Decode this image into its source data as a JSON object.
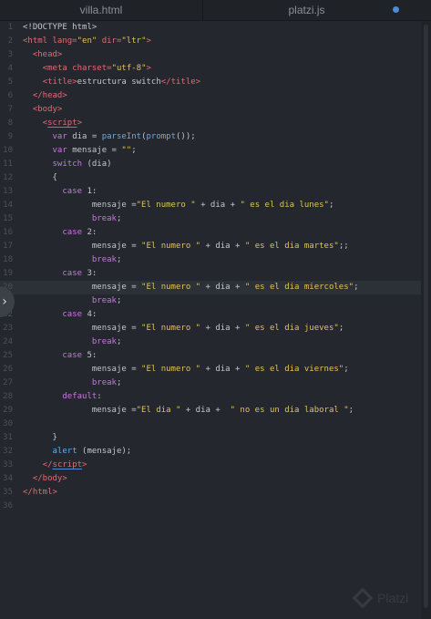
{
  "tabs": [
    {
      "label": "villa.html"
    },
    {
      "label": "platzi.js"
    }
  ],
  "colors": {
    "background": "#24272d",
    "tag": "#e06c75",
    "keyword": "#c678dd",
    "string": "#e0c35a",
    "function": "#61afef",
    "unsaved_dot": "#4d8bd6"
  },
  "active_line": 20,
  "lines": [
    {
      "n": "1",
      "tokens": [
        {
          "t": "<!DOCTYPE html>",
          "c": "pl"
        }
      ]
    },
    {
      "n": "2",
      "tokens": [
        {
          "t": "<html",
          "c": "tag"
        },
        {
          "t": " lang=",
          "c": "tag"
        },
        {
          "t": "\"en\"",
          "c": "str"
        },
        {
          "t": " dir=",
          "c": "tag"
        },
        {
          "t": "\"ltr\"",
          "c": "str"
        },
        {
          "t": ">",
          "c": "tag"
        }
      ]
    },
    {
      "n": "3",
      "tokens": [
        {
          "t": "  "
        },
        {
          "t": "<head>",
          "c": "tag"
        }
      ]
    },
    {
      "n": "4",
      "tokens": [
        {
          "t": "    "
        },
        {
          "t": "<meta",
          "c": "tag"
        },
        {
          "t": " charset=",
          "c": "tag"
        },
        {
          "t": "\"utf-8\"",
          "c": "str"
        },
        {
          "t": ">",
          "c": "tag"
        }
      ]
    },
    {
      "n": "5",
      "tokens": [
        {
          "t": "    "
        },
        {
          "t": "<title>",
          "c": "tag"
        },
        {
          "t": "estructura switch",
          "c": "pl"
        },
        {
          "t": "</title>",
          "c": "tag"
        }
      ]
    },
    {
      "n": "6",
      "tokens": [
        {
          "t": "  "
        },
        {
          "t": "</head>",
          "c": "tag"
        }
      ]
    },
    {
      "n": "7",
      "tokens": [
        {
          "t": "  "
        },
        {
          "t": "<body>",
          "c": "tag"
        }
      ]
    },
    {
      "n": "8",
      "tokens": [
        {
          "t": "    "
        },
        {
          "t": "<",
          "c": "tag"
        },
        {
          "t": "script",
          "c": "tag",
          "u": true
        },
        {
          "t": ">",
          "c": "tag"
        }
      ]
    },
    {
      "n": "9",
      "tokens": [
        {
          "t": "      "
        },
        {
          "t": "var",
          "c": "kw"
        },
        {
          "t": " dia = ",
          "c": "pl"
        },
        {
          "t": "parseInt",
          "c": "fn"
        },
        {
          "t": "(",
          "c": "pl"
        },
        {
          "t": "prompt",
          "c": "fn"
        },
        {
          "t": "());",
          "c": "pl"
        }
      ]
    },
    {
      "n": "10",
      "tokens": [
        {
          "t": "      "
        },
        {
          "t": "var",
          "c": "kw"
        },
        {
          "t": " mensaje = ",
          "c": "pl"
        },
        {
          "t": "\"\"",
          "c": "str"
        },
        {
          "t": ";",
          "c": "pl"
        }
      ]
    },
    {
      "n": "11",
      "tokens": [
        {
          "t": "      "
        },
        {
          "t": "switch",
          "c": "kw"
        },
        {
          "t": " (dia)",
          "c": "pl"
        }
      ]
    },
    {
      "n": "12",
      "tokens": [
        {
          "t": "      {",
          "c": "pl"
        }
      ]
    },
    {
      "n": "13",
      "tokens": [
        {
          "t": "        "
        },
        {
          "t": "case",
          "c": "kw"
        },
        {
          "t": " 1:",
          "c": "pl"
        }
      ]
    },
    {
      "n": "14",
      "tokens": [
        {
          "t": "              mensaje =",
          "c": "pl"
        },
        {
          "t": "\"El numero \"",
          "c": "str"
        },
        {
          "t": " + dia + ",
          "c": "pl"
        },
        {
          "t": "\" es el dia lunes\"",
          "c": "str"
        },
        {
          "t": ";",
          "c": "pl"
        }
      ]
    },
    {
      "n": "15",
      "tokens": [
        {
          "t": "              "
        },
        {
          "t": "break",
          "c": "kw"
        },
        {
          "t": ";",
          "c": "pl"
        }
      ]
    },
    {
      "n": "16",
      "tokens": [
        {
          "t": "        "
        },
        {
          "t": "case",
          "c": "kw"
        },
        {
          "t": " 2:",
          "c": "pl"
        }
      ]
    },
    {
      "n": "17",
      "tokens": [
        {
          "t": "              mensaje = ",
          "c": "pl"
        },
        {
          "t": "\"El numero \"",
          "c": "str"
        },
        {
          "t": " + dia + ",
          "c": "pl"
        },
        {
          "t": "\" es el dia martes\"",
          "c": "str"
        },
        {
          "t": ";;",
          "c": "pl"
        }
      ]
    },
    {
      "n": "18",
      "tokens": [
        {
          "t": "              "
        },
        {
          "t": "break",
          "c": "kw"
        },
        {
          "t": ";",
          "c": "pl"
        }
      ]
    },
    {
      "n": "19",
      "tokens": [
        {
          "t": "        "
        },
        {
          "t": "case",
          "c": "kw"
        },
        {
          "t": " 3:",
          "c": "pl"
        }
      ]
    },
    {
      "n": "20",
      "tokens": [
        {
          "t": "              mensaje = ",
          "c": "pl"
        },
        {
          "t": "\"El numero \"",
          "c": "str"
        },
        {
          "t": " + dia + ",
          "c": "pl"
        },
        {
          "t": "\" es el dia miercoles\"",
          "c": "str"
        },
        {
          "t": ";",
          "c": "pl"
        }
      ]
    },
    {
      "n": "21",
      "tokens": [
        {
          "t": "              "
        },
        {
          "t": "break",
          "c": "kw"
        },
        {
          "t": ";",
          "c": "pl"
        }
      ]
    },
    {
      "n": "22",
      "tokens": [
        {
          "t": "        "
        },
        {
          "t": "case",
          "c": "kw"
        },
        {
          "t": " 4:",
          "c": "pl"
        }
      ]
    },
    {
      "n": "23",
      "tokens": [
        {
          "t": "              mensaje = ",
          "c": "pl"
        },
        {
          "t": "\"El numero \"",
          "c": "str"
        },
        {
          "t": " + dia + ",
          "c": "pl"
        },
        {
          "t": "\" es el dia jueves\"",
          "c": "str"
        },
        {
          "t": ";",
          "c": "pl"
        }
      ]
    },
    {
      "n": "24",
      "tokens": [
        {
          "t": "              "
        },
        {
          "t": "break",
          "c": "kw"
        },
        {
          "t": ";",
          "c": "pl"
        }
      ]
    },
    {
      "n": "25",
      "tokens": [
        {
          "t": "        "
        },
        {
          "t": "case",
          "c": "kw"
        },
        {
          "t": " 5:",
          "c": "pl"
        }
      ]
    },
    {
      "n": "26",
      "tokens": [
        {
          "t": "              mensaje = ",
          "c": "pl"
        },
        {
          "t": "\"El numero \"",
          "c": "str"
        },
        {
          "t": " + dia + ",
          "c": "pl"
        },
        {
          "t": "\" es el dia viernes\"",
          "c": "str"
        },
        {
          "t": ";",
          "c": "pl"
        }
      ]
    },
    {
      "n": "27",
      "tokens": [
        {
          "t": "              "
        },
        {
          "t": "break",
          "c": "kw"
        },
        {
          "t": ";",
          "c": "pl"
        }
      ]
    },
    {
      "n": "28",
      "tokens": [
        {
          "t": "        "
        },
        {
          "t": "default",
          "c": "kw"
        },
        {
          "t": ":",
          "c": "pl"
        }
      ]
    },
    {
      "n": "29",
      "tokens": [
        {
          "t": "              mensaje =",
          "c": "pl"
        },
        {
          "t": "\"El dia \"",
          "c": "str"
        },
        {
          "t": " + dia +  ",
          "c": "pl"
        },
        {
          "t": "\" no es un dia laboral \"",
          "c": "str"
        },
        {
          "t": ";",
          "c": "pl"
        }
      ]
    },
    {
      "n": "30",
      "tokens": []
    },
    {
      "n": "31",
      "tokens": [
        {
          "t": "      }",
          "c": "pl"
        }
      ]
    },
    {
      "n": "32",
      "tokens": [
        {
          "t": "      "
        },
        {
          "t": "alert",
          "c": "fn"
        },
        {
          "t": " (mensaje);",
          "c": "pl"
        }
      ]
    },
    {
      "n": "33",
      "tokens": [
        {
          "t": "    "
        },
        {
          "t": "</",
          "c": "tag"
        },
        {
          "t": "script",
          "c": "tag",
          "u": true
        },
        {
          "t": ">",
          "c": "tag"
        }
      ]
    },
    {
      "n": "34",
      "tokens": [
        {
          "t": "  "
        },
        {
          "t": "</body>",
          "c": "tag"
        }
      ]
    },
    {
      "n": "35",
      "tokens": [
        {
          "t": "</html>",
          "c": "tag"
        }
      ]
    },
    {
      "n": "36",
      "tokens": []
    }
  ],
  "watermark": {
    "text": "Platzi"
  }
}
